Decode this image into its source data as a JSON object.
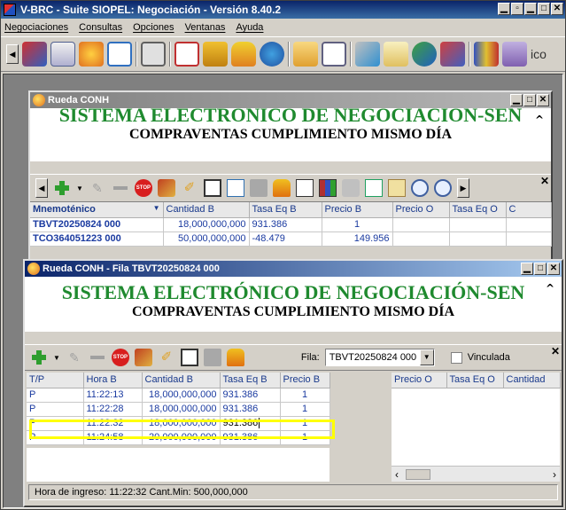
{
  "app": {
    "title": "V-BRC - Suite SIOPEL: Negociación - Versión 8.40.2",
    "menu": [
      "Negociaciones",
      "Consultas",
      "Opciones",
      "Ventanas",
      "Ayuda"
    ],
    "toolbar_tail_text": "ico"
  },
  "window1": {
    "title": "Rueda CONH",
    "banner_line1": "SISTEMA ELECTRONICO DE NEGOCIACION-SEN",
    "banner_line2": "COMPRAVENTAS CUMPLIMIENTO MISMO DÍA",
    "columns": [
      "Mnemoténico",
      "Cantidad B",
      "Tasa Eq B",
      "Precio B",
      "Precio O",
      "Tasa Eq O",
      "C"
    ],
    "rows": [
      [
        "TBVT20250824 000",
        "18,000,000,000",
        "931.386",
        "1",
        "",
        "",
        ""
      ],
      [
        "TCO364051223 000",
        "50,000,000,000",
        "-48.479",
        "149.956",
        "",
        "",
        ""
      ]
    ]
  },
  "window2": {
    "title": "Rueda CONH - Fila TBVT20250824 000",
    "banner_line1": "SISTEMA ELECTRÓNICO DE NEGOCIACIÓN-SEN",
    "banner_line2": "COMPRAVENTAS CUMPLIMIENTO MISMO DÍA",
    "fila_label": "Fila:",
    "fila_value": "TBVT20250824 000",
    "vinculada_label": "Vinculada",
    "left_columns": [
      "T/P",
      "Hora B",
      "Cantidad B",
      "Tasa Eq B",
      "Precio B"
    ],
    "left_rows": [
      [
        "P",
        "11:22:13",
        "18,000,000,000",
        "931.386",
        "1"
      ],
      [
        "P",
        "11:22:28",
        "18,000,000,000",
        "931.386",
        "1"
      ],
      [
        "P",
        "11:22:32",
        "18,000,000,000",
        "931.386",
        "1"
      ],
      [
        "P",
        "11:24:58",
        "20,000,000,000",
        "931.386",
        "1"
      ]
    ],
    "right_columns": [
      "Precio O",
      "Tasa Eq O",
      "Cantidad"
    ],
    "status": "Hora de ingreso: 11:22:32  Cant.Min: 500,000,000"
  },
  "colors": {
    "banner_green": "#1f8a2f",
    "highlight": "#ffff00",
    "grid_text": "#1a3aa0"
  }
}
